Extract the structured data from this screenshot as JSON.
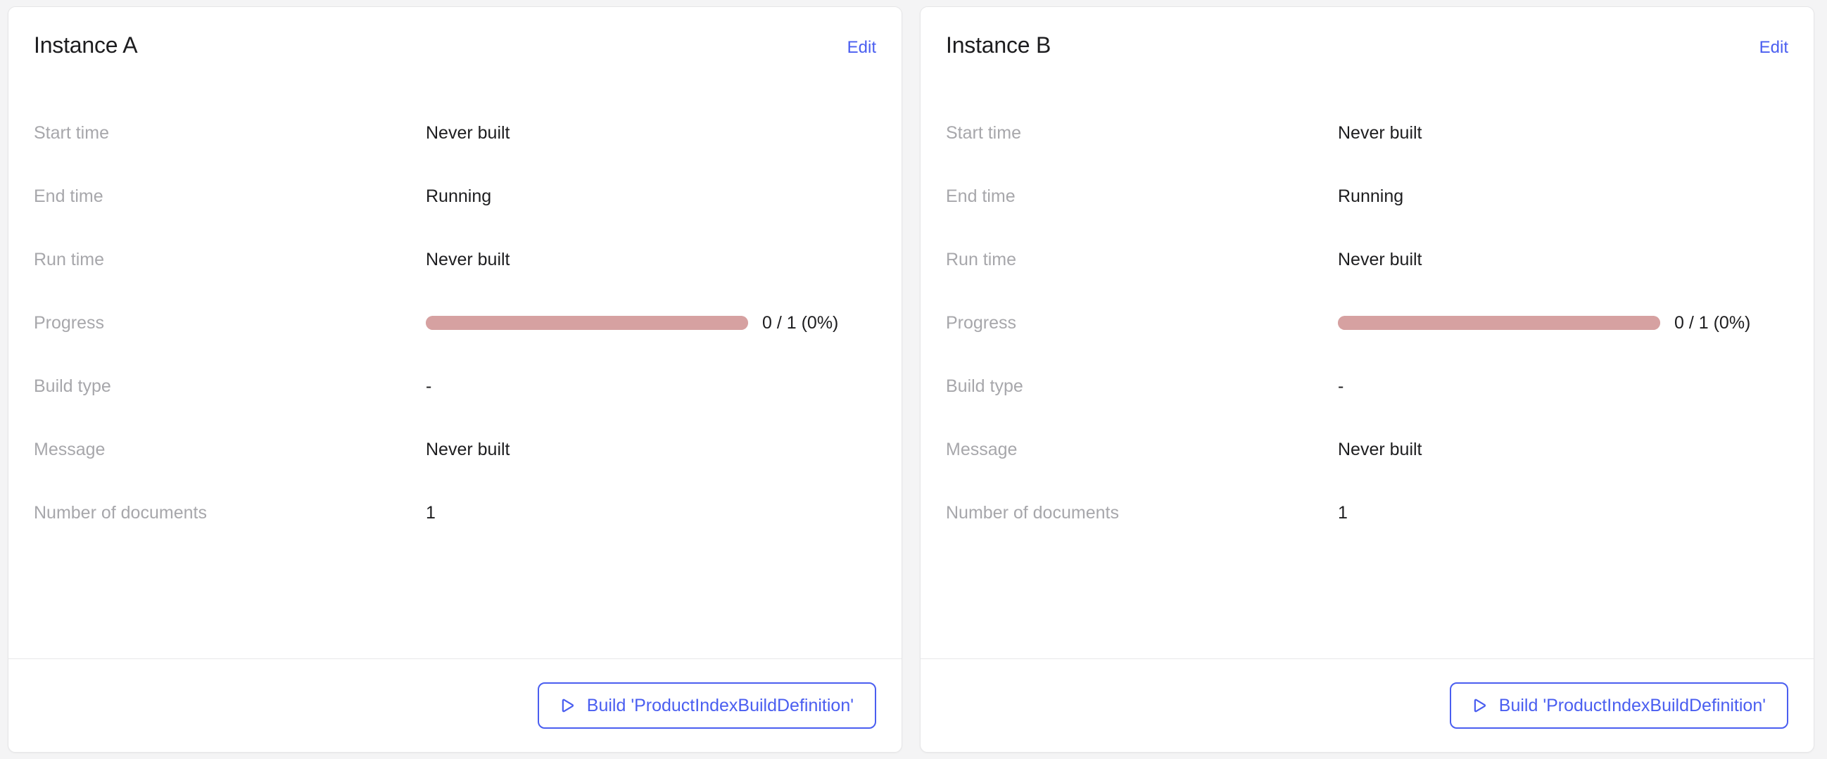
{
  "theme": {
    "page_background": "#f4f4f5",
    "card_background": "#ffffff",
    "card_border": "#e6e6e8",
    "accent": "#4a5ef0",
    "label_color": "#a7a7ab",
    "value_color": "#1d1d1f",
    "progress_color": "#d6a1a1"
  },
  "cards": [
    {
      "title": "Instance A",
      "edit_label": "Edit",
      "rows": [
        {
          "label": "Start time",
          "value": "Never built"
        },
        {
          "label": "End time",
          "value": "Running"
        },
        {
          "label": "Run time",
          "value": "Never built"
        },
        {
          "label": "Progress",
          "value": "0 / 1 (0%)"
        },
        {
          "label": "Build type",
          "value": "-"
        },
        {
          "label": "Message",
          "value": "Never built"
        },
        {
          "label": "Number of documents",
          "value": "1"
        }
      ],
      "progress": {
        "text": "0 / 1 (0%)",
        "completed": 0,
        "total": 1,
        "percent": 0
      },
      "build_button_label": "Build 'ProductIndexBuildDefinition'",
      "build_button_icon": "play-icon"
    },
    {
      "title": "Instance B",
      "edit_label": "Edit",
      "rows": [
        {
          "label": "Start time",
          "value": "Never built"
        },
        {
          "label": "End time",
          "value": "Running"
        },
        {
          "label": "Run time",
          "value": "Never built"
        },
        {
          "label": "Progress",
          "value": "0 / 1 (0%)"
        },
        {
          "label": "Build type",
          "value": "-"
        },
        {
          "label": "Message",
          "value": "Never built"
        },
        {
          "label": "Number of documents",
          "value": "1"
        }
      ],
      "progress": {
        "text": "0 / 1 (0%)",
        "completed": 0,
        "total": 1,
        "percent": 0
      },
      "build_button_label": "Build 'ProductIndexBuildDefinition'",
      "build_button_icon": "play-icon"
    }
  ]
}
